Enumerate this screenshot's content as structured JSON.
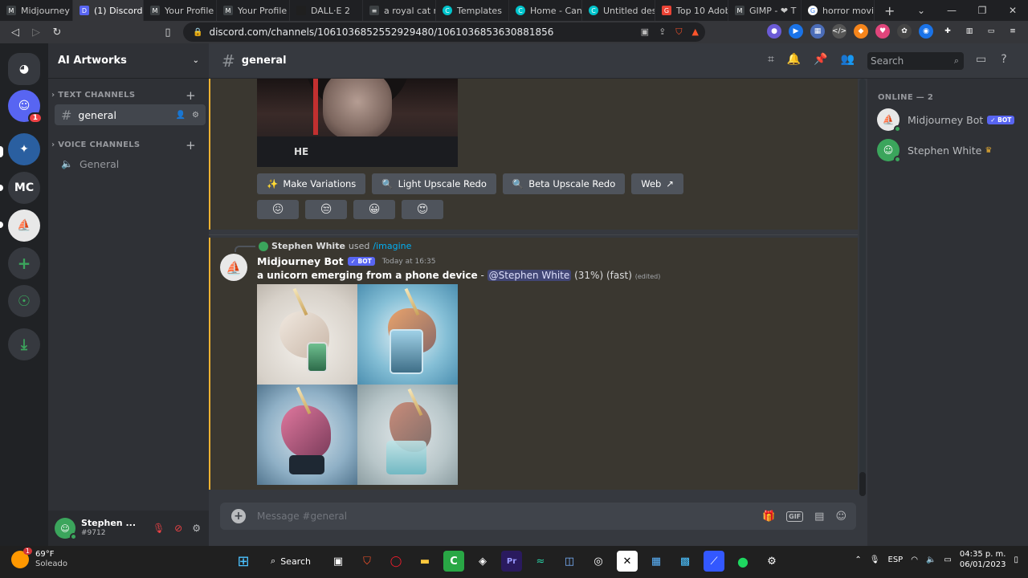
{
  "browser": {
    "tabs": [
      {
        "label": "Midjourney",
        "color": "#3c4043"
      },
      {
        "label": "(1) Discord",
        "color": "#5865f2",
        "active": true
      },
      {
        "label": "Your Profile",
        "color": "#3c4043"
      },
      {
        "label": "Your Profile",
        "color": "#3c4043"
      },
      {
        "label": "DALL·E 2",
        "color": "#1f1f1f"
      },
      {
        "label": "a royal cat ri",
        "color": "#3c4043"
      },
      {
        "label": "Templates",
        "color": "#00c4cc"
      },
      {
        "label": "Home - Canva",
        "color": "#00c4cc"
      },
      {
        "label": "Untitled desi",
        "color": "#00c4cc"
      },
      {
        "label": "Top 10 Adob",
        "color": "#ea4335"
      },
      {
        "label": "GIMP - ❤ T",
        "color": "#3c4043"
      },
      {
        "label": "horror movie",
        "color": "#4285f4"
      }
    ],
    "url": "discord.com/channels/1061036852552929480/1061036853630881856"
  },
  "discord": {
    "servers": [
      {
        "icon": "discord-home-icon",
        "glyph": "◕",
        "color": "#36393f"
      },
      {
        "icon": "discord-server-icon",
        "glyph": "☺",
        "color": "#5865f2",
        "badge": "1"
      },
      {
        "icon": "shark-server-icon",
        "glyph": "✦",
        "color": "#2a5fa0"
      },
      {
        "icon": "mc-server-icon",
        "glyph": "MC",
        "color": "#36393f"
      },
      {
        "icon": "midjourney-server-icon",
        "glyph": "⛵",
        "color": "#e8e8e8"
      },
      {
        "icon": "add-server-icon",
        "glyph": "+",
        "color": "#36393f"
      },
      {
        "icon": "explore-icon",
        "glyph": "☉",
        "color": "#36393f"
      },
      {
        "icon": "download-icon",
        "glyph": "⤓",
        "color": "#36393f"
      }
    ],
    "guild_name": "AI Artworks",
    "text_channels_label": "TEXT CHANNELS",
    "voice_channels_label": "VOICE CHANNELS",
    "text_channel": "general",
    "voice_channel": "General",
    "user": {
      "name": "Stephen ...",
      "tag": "#9712"
    },
    "channel_title": "general",
    "search_placeholder": "Search",
    "composer_placeholder": "Message #general",
    "members_header": "ONLINE — 2",
    "members": [
      {
        "name": "Midjourney Bot",
        "badge": "✓ BOT"
      },
      {
        "name": "Stephen White",
        "crown": "♛"
      }
    ],
    "message1": {
      "image_text": "HE",
      "buttons": [
        {
          "label": "Make Variations",
          "icon": "✨"
        },
        {
          "label": "Light Upscale Redo",
          "icon": "🔍"
        },
        {
          "label": "Beta Upscale Redo",
          "icon": "🔍"
        },
        {
          "label": "Web",
          "icon": "↗"
        }
      ],
      "reactions": [
        "😖",
        "😒",
        "😀",
        "😍"
      ]
    },
    "message2": {
      "reply_user": "Stephen White",
      "reply_verb": "used",
      "reply_command": "/imagine",
      "author": "Midjourney Bot",
      "badge": "✓ BOT",
      "time": "Today at 16:35",
      "prompt": "a unicorn emerging from a phone device",
      "separator": " - ",
      "mention": "@Stephen White",
      "progress": "(31%)",
      "mode": "(fast)",
      "edited": "(edited)"
    }
  },
  "taskbar": {
    "temp": "69°F",
    "condition": "Soleado",
    "weather_badge": "1",
    "search_label": "Search",
    "lang": "ESP",
    "time": "04:35 p. m.",
    "date": "06/01/2023"
  }
}
